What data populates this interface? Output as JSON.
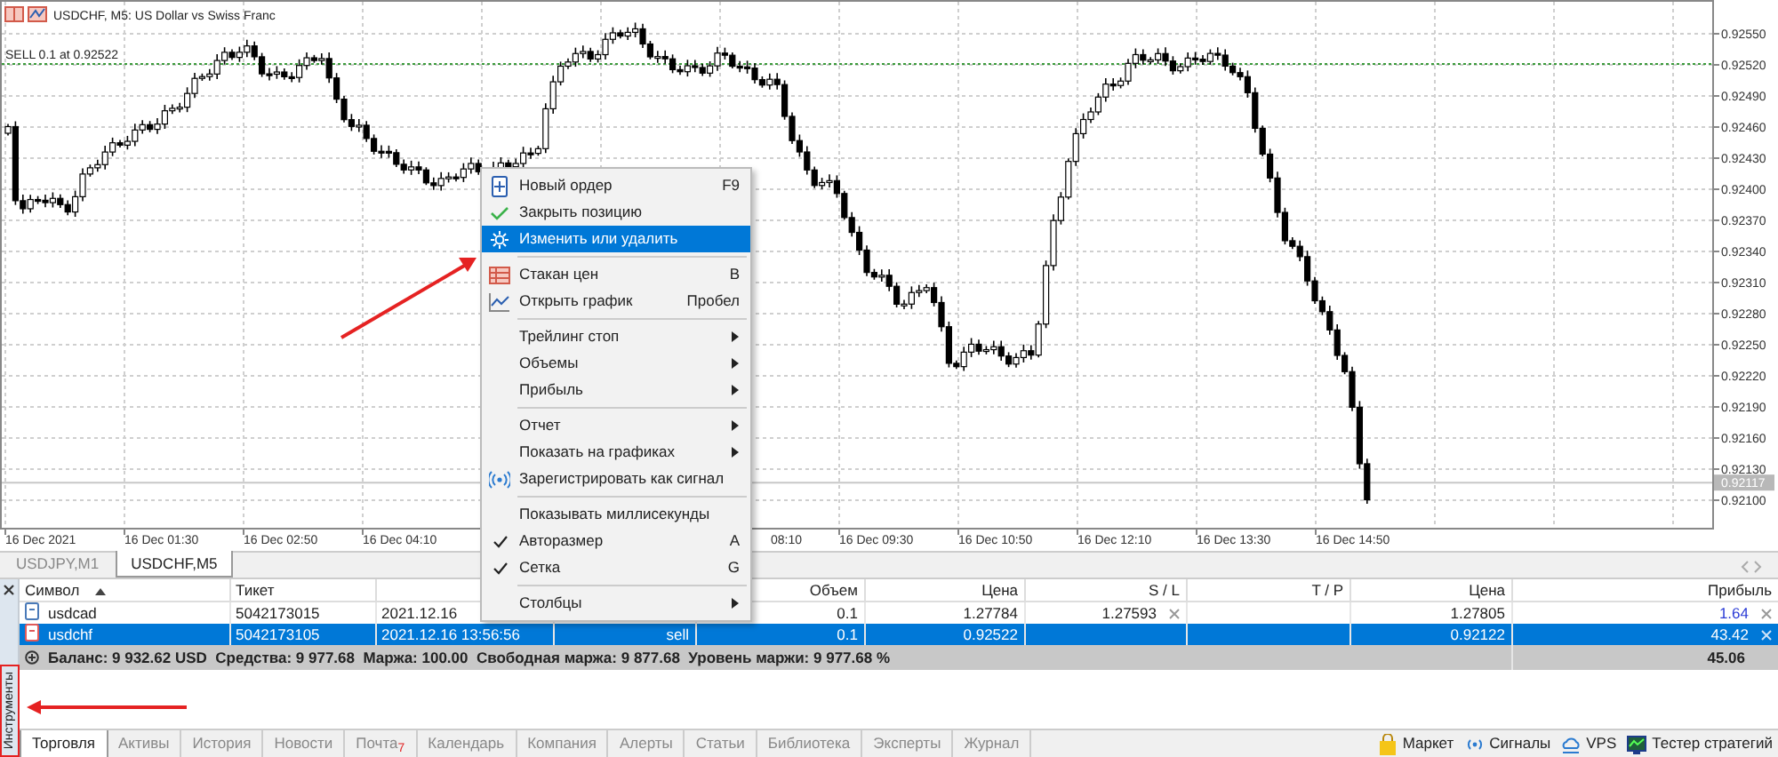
{
  "chart": {
    "title": "USDCHF, M5:  US Dollar vs Swiss Franc",
    "order_line": {
      "label": "SELL 0.1 at 0.92522"
    },
    "price_labels": [
      "0.92550",
      "0.92520",
      "0.92490",
      "0.92460",
      "0.92430",
      "0.92400",
      "0.92370",
      "0.92340",
      "0.92310",
      "0.92280",
      "0.92250",
      "0.92220",
      "0.92190",
      "0.92160",
      "0.92130",
      "0.92100"
    ],
    "current_price": "0.92117",
    "time_labels": [
      {
        "text": "16 Dec 2021",
        "cut": false
      },
      {
        "text": "16 Dec 01:30",
        "cut": false
      },
      {
        "text": "16 Dec 02:50",
        "cut": false
      },
      {
        "text": "16 Dec 04:10",
        "cut": false
      },
      {
        "text": "08:10",
        "cut": true
      },
      {
        "text": "16 Dec 09:30",
        "cut": false
      },
      {
        "text": "16 Dec 10:50",
        "cut": false
      },
      {
        "text": "16 Dec 12:10",
        "cut": false
      },
      {
        "text": "16 Dec 13:30",
        "cut": false
      },
      {
        "text": "16 Dec 14:50",
        "cut": false
      }
    ]
  },
  "chart_tabs": [
    {
      "label": "USDJPY,M1",
      "selected": false
    },
    {
      "label": "USDCHF,M5",
      "selected": true
    }
  ],
  "context_menu": {
    "groups": [
      [
        {
          "kind": "command",
          "label": "Новый ордер",
          "shortcut": "F9",
          "selected": false
        },
        {
          "kind": "command",
          "label": "Закрыть позицию",
          "selected": false
        },
        {
          "kind": "command",
          "label": "Изменить или удалить",
          "selected": true
        }
      ],
      [
        {
          "kind": "command",
          "label": "Стакан цен",
          "shortcut": "B",
          "selected": false
        },
        {
          "kind": "command",
          "label": "Открыть график",
          "shortcut": "Пробел",
          "selected": false
        }
      ],
      [
        {
          "kind": "submenu",
          "label": "Трейлинг стоп",
          "selected": false
        },
        {
          "kind": "submenu",
          "label": "Объемы",
          "selected": false
        },
        {
          "kind": "submenu",
          "label": "Прибыль",
          "selected": false
        }
      ],
      [
        {
          "kind": "submenu",
          "label": "Отчет",
          "selected": false
        },
        {
          "kind": "submenu",
          "label": "Показать на графиках",
          "selected": false
        },
        {
          "kind": "command",
          "label": "Зарегистрировать как сигнал",
          "selected": false
        }
      ],
      [
        {
          "kind": "toggle",
          "label": "Показывать миллисекунды",
          "checked": false,
          "selected": false
        },
        {
          "kind": "toggle",
          "label": "Авторазмер",
          "shortcut": "A",
          "checked": true,
          "selected": false
        },
        {
          "kind": "toggle",
          "label": "Сетка",
          "shortcut": "G",
          "checked": true,
          "selected": false
        }
      ],
      [
        {
          "kind": "submenu",
          "label": "Столбцы",
          "selected": false
        }
      ]
    ]
  },
  "table": {
    "headers": [
      {
        "label": "Символ",
        "sorted": true
      },
      {
        "label": "Тикет"
      },
      {
        "label": "Объем"
      },
      {
        "label": "Цена"
      },
      {
        "label": "S / L"
      },
      {
        "label": "T / P"
      },
      {
        "label": "Цена"
      },
      {
        "label": "Прибыль"
      }
    ],
    "rows": [
      {
        "symbol": "usdcad",
        "color": "#4a7ab8",
        "ticket": "5042173015",
        "time": "2021.12.16",
        "volume": "0.1",
        "price": "1.27784",
        "sl": "1.27593",
        "current_price": "1.27805",
        "profit": "1.64",
        "selected": false
      },
      {
        "symbol": "usdchf",
        "color": "#e05a5a",
        "ticket": "5042173105",
        "time": "2021.12.16 13:56:56",
        "type": "sell",
        "volume": "0.1",
        "price": "0.92522",
        "current_price": "0.92122",
        "profit": "43.42",
        "selected": true
      }
    ],
    "summary": {
      "text": "Баланс: 9 932.62 USD  Средства: 9 977.68  Маржа: 100.00  Свободная маржа: 9 877.68  Уровень маржи: 9 977.68 %",
      "total": "45.06"
    }
  },
  "side_panel": {
    "title": "Инструменты"
  },
  "bottom_tabs": [
    {
      "label": "Торговля",
      "selected": true
    },
    {
      "label": "Активы",
      "selected": false
    },
    {
      "label": "История",
      "selected": false
    },
    {
      "label": "Новости",
      "selected": false
    },
    {
      "label": "Почта",
      "badge": "7",
      "selected": false
    },
    {
      "label": "Календарь",
      "selected": false
    },
    {
      "label": "Компания",
      "selected": false
    },
    {
      "label": "Алерты",
      "selected": false
    },
    {
      "label": "Статьи",
      "selected": false
    },
    {
      "label": "Библиотека",
      "selected": false
    },
    {
      "label": "Эксперты",
      "selected": false
    },
    {
      "label": "Журнал",
      "selected": false
    }
  ],
  "status_links": [
    {
      "label": "Маркет"
    },
    {
      "label": "Сигналы"
    },
    {
      "label": "VPS"
    },
    {
      "label": "Тестер стратегий"
    }
  ]
}
